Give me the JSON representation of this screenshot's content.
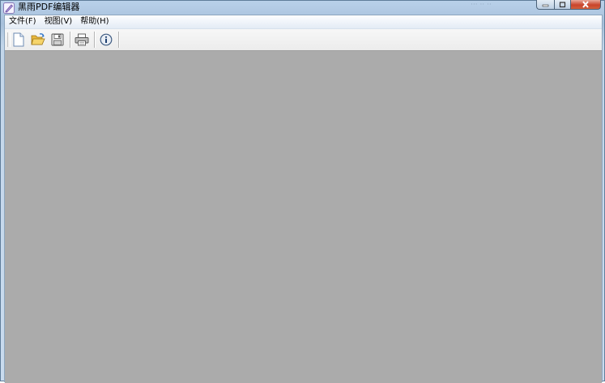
{
  "window": {
    "title": "黑雨PDF编辑器",
    "app_icon": "pdf-app-icon",
    "background_hint": "··· ·· ··",
    "controls": {
      "minimize_icon": "minimize-icon",
      "maximize_icon": "maximize-icon",
      "close_icon": "close-icon"
    }
  },
  "menubar": {
    "items": [
      {
        "label": "文件(F)"
      },
      {
        "label": "视图(V)"
      },
      {
        "label": "帮助(H)"
      }
    ]
  },
  "toolbar": {
    "buttons": [
      {
        "icon": "new-document-icon"
      },
      {
        "icon": "open-folder-icon"
      },
      {
        "icon": "save-icon"
      },
      {
        "icon": "print-icon"
      },
      {
        "icon": "info-icon"
      }
    ]
  },
  "colors": {
    "workspace": "#ababab",
    "menubar": "#e8eef6",
    "toolbar": "#f0f0f0",
    "close_button": "#c9442b"
  }
}
